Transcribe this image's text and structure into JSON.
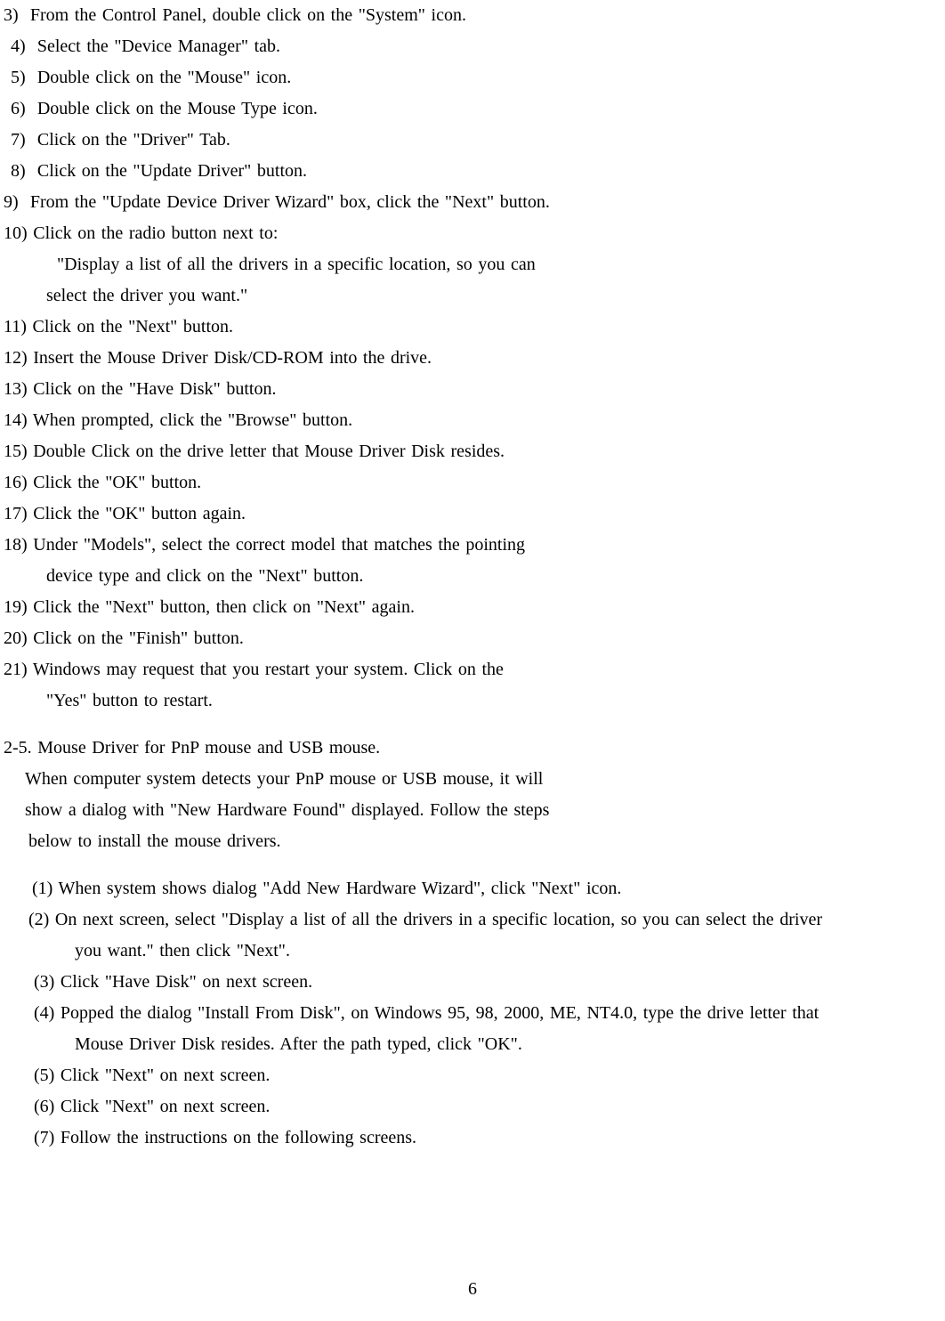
{
  "steps_a": [
    {
      "indent": "indent-1",
      "text": "3)  From the Control Panel, double click on the \"System\" icon."
    },
    {
      "indent": "indent-2",
      "text": "4)  Select the \"Device Manager\" tab."
    },
    {
      "indent": "indent-2",
      "text": "5)  Double click on the \"Mouse\" icon."
    },
    {
      "indent": "indent-2",
      "text": "6)  Double click on the Mouse Type icon."
    },
    {
      "indent": "indent-2",
      "text": "7)  Click on the \"Driver\" Tab."
    },
    {
      "indent": "indent-2",
      "text": "8)  Click on the \"Update Driver\" button."
    },
    {
      "indent": "indent-1",
      "text": "9)  From the \"Update Device Driver Wizard\" box, click the \"Next\" button."
    },
    {
      "indent": "indent-1",
      "text": "10) Click on the radio button next to:"
    },
    {
      "indent": "indent-5",
      "text": "\"Display a list of all the drivers in a specific location, so you can"
    },
    {
      "indent": "indent-4",
      "text": "select the driver you want.\""
    },
    {
      "indent": "indent-1",
      "text": "11) Click on the \"Next\" button."
    },
    {
      "indent": "indent-1",
      "text": "12) Insert the Mouse Driver Disk/CD-ROM into the drive."
    },
    {
      "indent": "indent-1",
      "text": "13) Click on the \"Have Disk\" button."
    },
    {
      "indent": "indent-1",
      "text": "14) When prompted, click the \"Browse\" button."
    },
    {
      "indent": "indent-1",
      "text": "15) Double Click on the drive letter that Mouse Driver Disk resides."
    },
    {
      "indent": "indent-1",
      "text": "16) Click the \"OK\" button."
    },
    {
      "indent": "indent-1",
      "text": "17) Click the \"OK\" button again."
    },
    {
      "indent": "indent-1",
      "text": "18) Under \"Models\", select the correct model that matches the pointing"
    },
    {
      "indent": "indent-4",
      "text": "device type and click on the \"Next\" button."
    },
    {
      "indent": "indent-1",
      "text": "19) Click the \"Next\" button, then click on \"Next\" again."
    },
    {
      "indent": "indent-1",
      "text": "20) Click on the \"Finish\" button."
    },
    {
      "indent": "indent-1",
      "text": "21) Windows may request that you restart your system. Click on the"
    },
    {
      "indent": "indent-4",
      "text": "\"Yes\" button to restart."
    }
  ],
  "section_b_header": "2-5. Mouse Driver for PnP mouse and USB mouse.",
  "section_b_intro": [
    {
      "indent": "indent-6",
      "text": "When computer system detects your PnP mouse or USB mouse, it will"
    },
    {
      "indent": "indent-6",
      "text": "show a dialog with \"New Hardware Found\" displayed. Follow the steps"
    },
    {
      "indent": "indent-7",
      "text": "below to install the mouse drivers."
    }
  ],
  "steps_b": [
    {
      "indent": "indent-8",
      "text": "(1) When system shows dialog \"Add New Hardware Wizard\", click \"Next\" icon."
    },
    {
      "indent": "indent-7",
      "text": "(2) On next screen, select \"Display a list of all the drivers in a specific location, so you can select the driver"
    },
    {
      "indent": "indent-10",
      "text": "you want.\" then click \"Next\"."
    },
    {
      "indent": "indent-9",
      "text": "(3) Click \"Have Disk\" on next screen."
    },
    {
      "indent": "indent-9",
      "text": "(4) Popped the dialog \"Install From Disk\", on Windows 95, 98, 2000, ME, NT4.0, type the drive letter that"
    },
    {
      "indent": "indent-10",
      "text": "Mouse Driver Disk resides. After the path typed, click \"OK\"."
    },
    {
      "indent": "indent-9",
      "text": "(5) Click \"Next\" on next screen."
    },
    {
      "indent": "indent-9",
      "text": "(6) Click \"Next\" on next screen."
    },
    {
      "indent": "indent-9",
      "text": "(7) Follow the instructions on the following screens."
    }
  ],
  "page_number": "6"
}
